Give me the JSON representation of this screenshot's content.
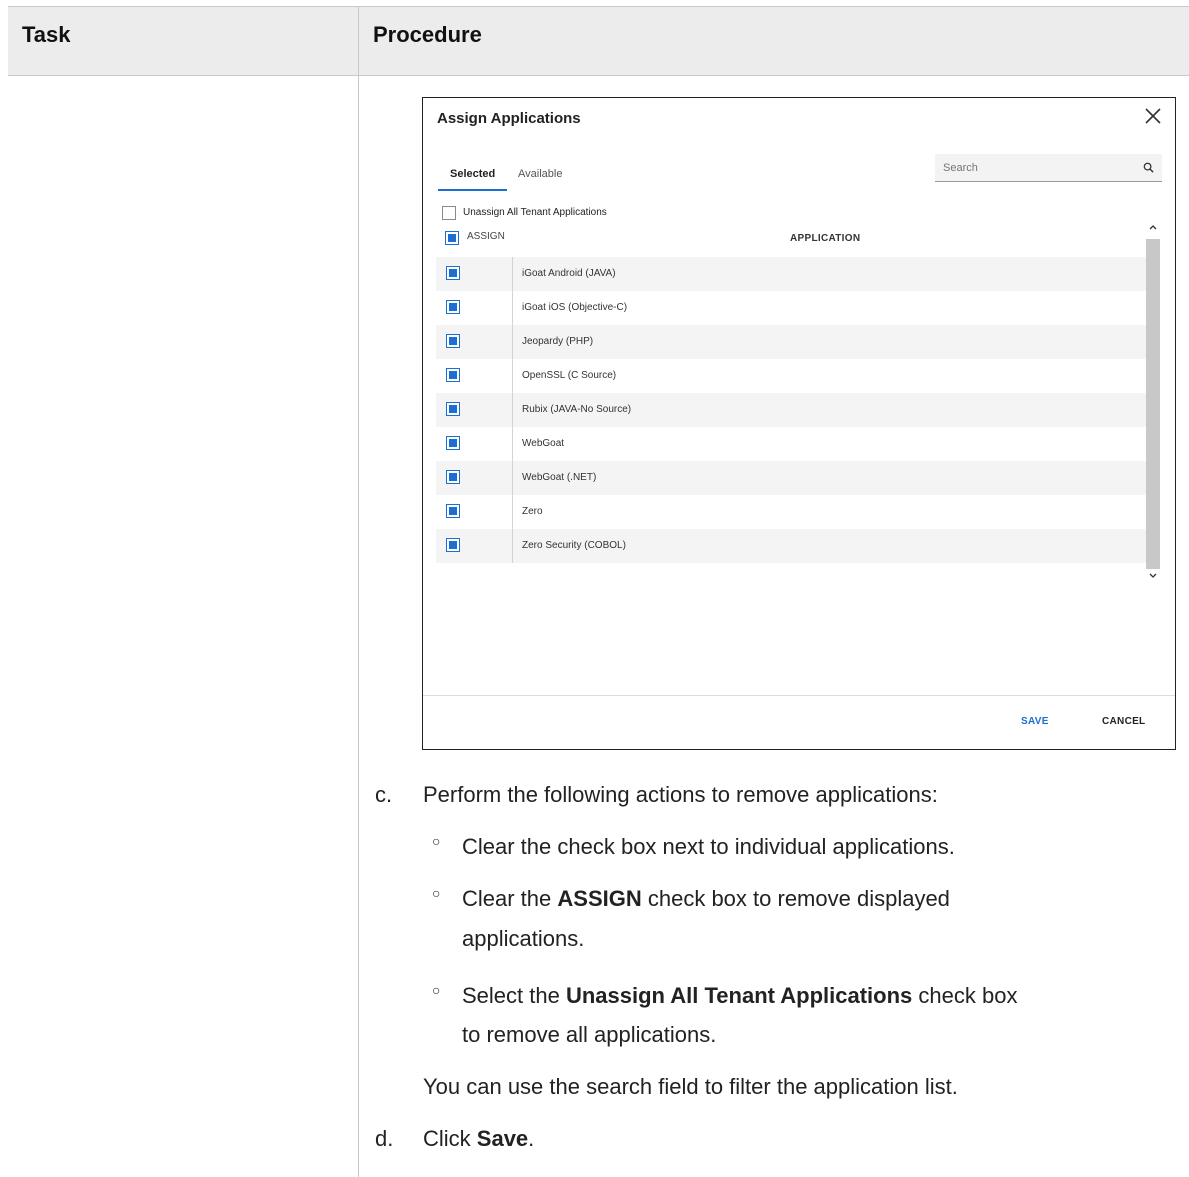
{
  "table": {
    "header_task": "Task",
    "header_procedure": "Procedure"
  },
  "dialog": {
    "title": "Assign Applications",
    "tabs": [
      {
        "label": "Selected",
        "active": true
      },
      {
        "label": "Available",
        "active": false
      }
    ],
    "search_placeholder": "Search",
    "unassign_all_label": "Unassign All Tenant Applications",
    "unassign_all_checked": false,
    "assign_label": "ASSIGN",
    "assign_checked": true,
    "column_application": "APPLICATION",
    "applications": [
      {
        "name": "iGoat Android (JAVA)",
        "checked": true
      },
      {
        "name": "iGoat iOS (Objective-C)",
        "checked": true
      },
      {
        "name": "Jeopardy (PHP)",
        "checked": true
      },
      {
        "name": "OpenSSL (C Source)",
        "checked": true
      },
      {
        "name": "Rubix (JAVA-No Source)",
        "checked": true
      },
      {
        "name": "WebGoat",
        "checked": true
      },
      {
        "name": "WebGoat (.NET)",
        "checked": true
      },
      {
        "name": "Zero",
        "checked": true
      },
      {
        "name": "Zero Security (COBOL)",
        "checked": true
      }
    ],
    "save_label": "SAVE",
    "cancel_label": "CANCEL",
    "accent_color": "#1a6fd1"
  },
  "procedure": {
    "step_c_marker": "c.",
    "step_c_text": "Perform the following actions to remove applications:",
    "bullet_1": "Clear the check box next to individual applications.",
    "bullet_2_pre": "Clear the ",
    "bullet_2_bold": "ASSIGN",
    "bullet_2_post_line1": " check box to remove displayed",
    "bullet_2_line2": "applications.",
    "bullet_3_pre": "Select the ",
    "bullet_3_bold": "Unassign All Tenant Applications",
    "bullet_3_post_line1": " check box",
    "bullet_3_line2": "to remove all applications.",
    "search_note": "You can use the search field to filter the application list.",
    "step_d_marker": "d.",
    "step_d_pre": "Click ",
    "step_d_bold": "Save",
    "step_d_post": "."
  }
}
